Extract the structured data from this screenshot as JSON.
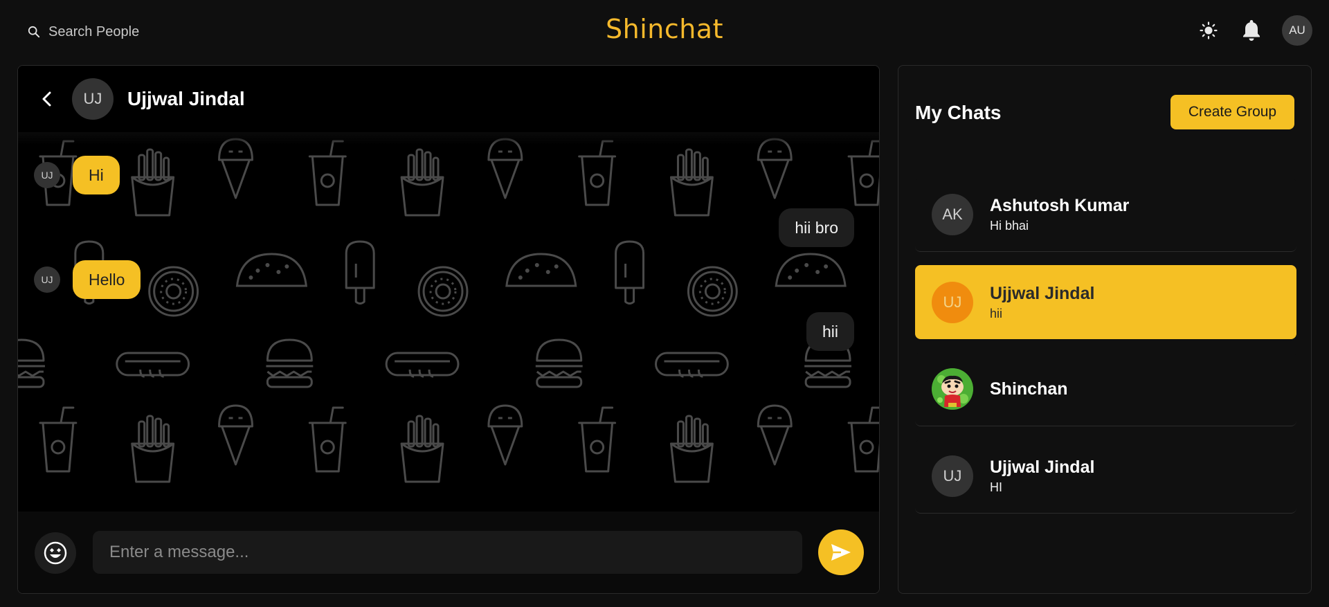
{
  "app": {
    "title": "Shinchat",
    "accent_color": "#f5c024"
  },
  "topbar": {
    "search_label": "Search People",
    "theme_icon": "sun-icon",
    "notification_icon": "bell-icon",
    "user_initials": "AU"
  },
  "chat": {
    "name": "Ujjwal Jindal",
    "initials": "UJ",
    "messages": [
      {
        "text": "Hi",
        "sender_initials": "UJ",
        "direction": "incoming"
      },
      {
        "text": "hii bro",
        "direction": "outgoing"
      },
      {
        "text": "Hello",
        "sender_initials": "UJ",
        "direction": "incoming"
      },
      {
        "text": "hii",
        "direction": "outgoing"
      }
    ],
    "composer": {
      "placeholder": "Enter a message...",
      "emoji_icon": "emoji-icon",
      "send_icon": "send-icon"
    }
  },
  "sidebar": {
    "title": "My Chats",
    "create_group_label": "Create Group",
    "chats": [
      {
        "name": "Ashutosh Kumar",
        "last_message": "Hi bhai",
        "initials": "AK",
        "active": false
      },
      {
        "name": "Ujjwal Jindal",
        "last_message": "hii",
        "initials": "UJ",
        "active": true
      },
      {
        "name": "Shinchan",
        "last_message": "",
        "avatar": "shinchan-picture",
        "active": false
      },
      {
        "name": "Ujjwal Jindal",
        "last_message": "HI",
        "initials": "UJ",
        "active": false
      }
    ]
  }
}
